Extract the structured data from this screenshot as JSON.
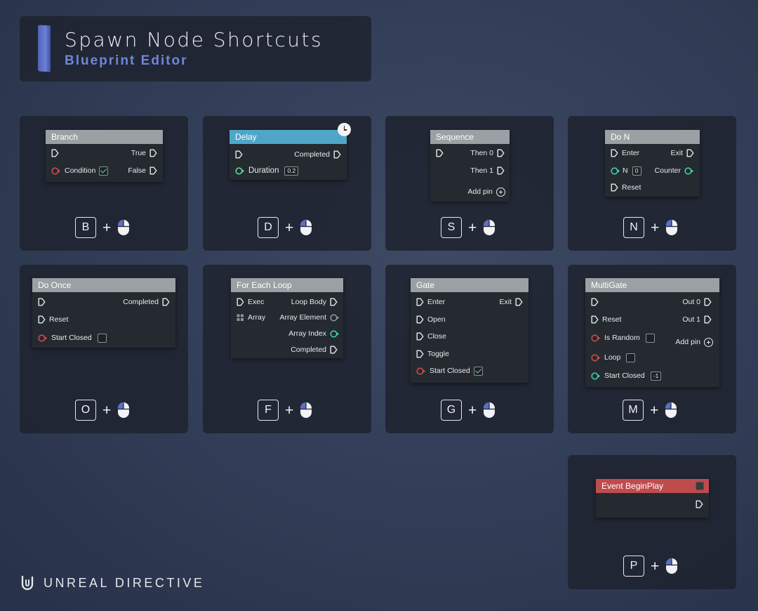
{
  "header": {
    "title": "Spawn Node Shortcuts",
    "subtitle": "Blueprint Editor"
  },
  "brand": {
    "name": "UNREAL DIRECTIVE"
  },
  "colors": {
    "exec": "#e8eaec",
    "bool_pin": "#d34a48",
    "float_pin": "#5fd896",
    "int_pin": "#3fd0a8",
    "accent": "#6f86d8"
  },
  "icons": {
    "mouse": "mouse-left-click-icon",
    "exec": "exec-pin-icon",
    "addpin": "add-pin-plus-icon",
    "clock": "clock-icon"
  },
  "cards": [
    {
      "node_title": "Branch",
      "key": "B",
      "rows": {
        "out_true": "True",
        "in_condition": "Condition",
        "out_false": "False"
      }
    },
    {
      "node_title": "Delay",
      "key": "D",
      "rows": {
        "out_completed": "Completed",
        "in_duration": "Duration",
        "duration_value": "0.2"
      }
    },
    {
      "node_title": "Sequence",
      "key": "S",
      "rows": {
        "out_then0": "Then 0",
        "out_then1": "Then 1",
        "add_pin": "Add pin"
      }
    },
    {
      "node_title": "Do N",
      "key": "N",
      "rows": {
        "in_enter": "Enter",
        "out_exit": "Exit",
        "in_n": "N",
        "n_value": "0",
        "out_counter": "Counter",
        "in_reset": "Reset"
      }
    },
    {
      "node_title": "Do Once",
      "key": "O",
      "rows": {
        "out_completed": "Completed",
        "in_reset": "Reset",
        "in_start_closed": "Start Closed"
      }
    },
    {
      "node_title": "For Each Loop",
      "key": "F",
      "rows": {
        "in_exec": "Exec",
        "out_loop_body": "Loop Body",
        "in_array": "Array",
        "out_array_element": "Array Element",
        "out_array_index": "Array Index",
        "out_completed": "Completed"
      }
    },
    {
      "node_title": "Gate",
      "key": "G",
      "rows": {
        "in_enter": "Enter",
        "out_exit": "Exit",
        "in_open": "Open",
        "in_close": "Close",
        "in_toggle": "Toggle",
        "in_start_closed": "Start Closed"
      }
    },
    {
      "node_title": "MultiGate",
      "key": "M",
      "rows": {
        "out_out0": "Out 0",
        "in_reset": "Reset",
        "out_out1": "Out 1",
        "in_is_random": "Is Random",
        "add_pin": "Add pin",
        "in_loop": "Loop",
        "in_start_closed": "Start Closed",
        "start_closed_value": "-1"
      }
    },
    {
      "node_title": "Event BeginPlay",
      "key": "P",
      "rows": {}
    }
  ]
}
